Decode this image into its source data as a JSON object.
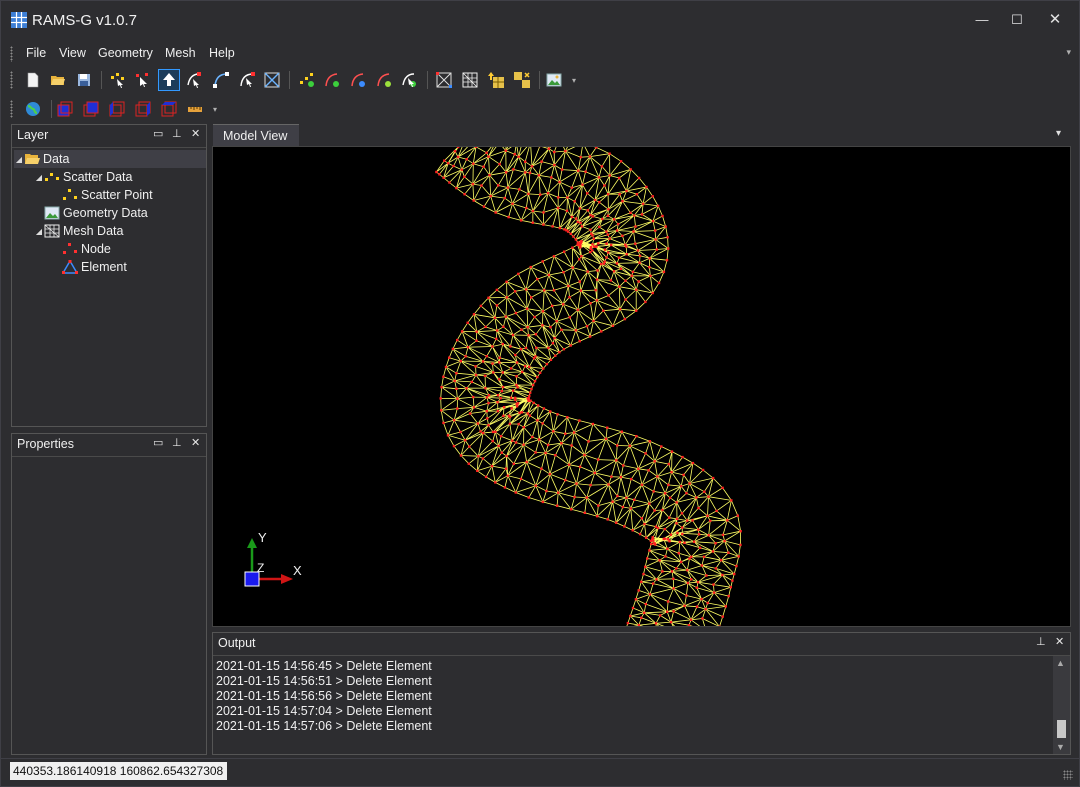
{
  "window": {
    "title": "RAMS-G v1.0.7",
    "controls": {
      "minimize": "—",
      "maximize": "☐",
      "close": "✕"
    }
  },
  "menu": {
    "items": [
      "File",
      "View",
      "Geometry",
      "Mesh",
      "Help"
    ],
    "overflow": "▾"
  },
  "toolbar1": {
    "buttons": [
      {
        "icon": "new-file-icon"
      },
      {
        "icon": "open-folder-icon"
      },
      {
        "icon": "save-icon"
      },
      {
        "icon": "zoom-scatter-icon"
      },
      {
        "icon": "move-point-icon"
      },
      {
        "icon": "select-arrow-icon",
        "active": true
      },
      {
        "icon": "select-vertex-icon"
      },
      {
        "icon": "create-arc-icon"
      },
      {
        "icon": "select-arc-icon"
      },
      {
        "icon": "delete-mesh-icon"
      },
      {
        "icon": "add-node-icon"
      },
      {
        "icon": "arc-green-icon"
      },
      {
        "icon": "arc-blue-icon"
      },
      {
        "icon": "arc-green2-icon"
      },
      {
        "icon": "select-node-icon"
      },
      {
        "icon": "mesh-polygon-icon"
      },
      {
        "icon": "mesh-grid-icon"
      },
      {
        "icon": "refine-up-icon"
      },
      {
        "icon": "refine-down-icon"
      },
      {
        "icon": "image-icon"
      }
    ],
    "more": "▾"
  },
  "toolbar2": {
    "buttons": [
      {
        "icon": "globe-icon"
      },
      {
        "icon": "view-front-icon"
      },
      {
        "icon": "view-back-icon"
      },
      {
        "icon": "view-left-icon"
      },
      {
        "icon": "view-right-icon"
      },
      {
        "icon": "view-top-icon"
      },
      {
        "icon": "ruler-icon"
      }
    ],
    "more": "▾"
  },
  "layer_panel": {
    "title": "Layer",
    "controls": {
      "float": "▭",
      "pin": "⊥",
      "close": "✕"
    },
    "tree": [
      {
        "label": "Data",
        "level": 0,
        "expanded": true,
        "icon": "folder-open-icon",
        "selected": true
      },
      {
        "label": "Scatter Data",
        "level": 1,
        "expanded": true,
        "icon": "scatter-data-icon"
      },
      {
        "label": "Scatter Point",
        "level": 2,
        "icon": "scatter-point-icon"
      },
      {
        "label": "Geometry Data",
        "level": 1,
        "icon": "geometry-data-icon"
      },
      {
        "label": "Mesh Data",
        "level": 1,
        "expanded": true,
        "icon": "mesh-data-icon"
      },
      {
        "label": "Node",
        "level": 2,
        "icon": "node-icon"
      },
      {
        "label": "Element",
        "level": 2,
        "icon": "element-icon"
      }
    ]
  },
  "properties_panel": {
    "title": "Properties",
    "controls": {
      "float": "▭",
      "pin": "⊥",
      "close": "✕"
    }
  },
  "model_view": {
    "tab": "Model View",
    "dropdown": "▾",
    "axes": {
      "x_label": "X",
      "y_label": "Y",
      "z_label": "Z"
    }
  },
  "output_panel": {
    "title": "Output",
    "controls": {
      "pin": "⊥",
      "close": "✕"
    },
    "log": [
      "2021-01-15 14:56:45 > Delete Element",
      "2021-01-15 14:56:51 > Delete Element",
      "2021-01-15 14:56:56 > Delete Element",
      "2021-01-15 14:57:04 > Delete Element",
      "2021-01-15 14:57:06 > Delete Element"
    ]
  },
  "status_bar": {
    "coordinates": "440353.186140918 160862.654327308"
  },
  "colors": {
    "background": "#2d2d30",
    "viewport": "#000000",
    "mesh_edge": "#ffff66",
    "mesh_node": "#ff2020",
    "accent": "#3399ff"
  }
}
